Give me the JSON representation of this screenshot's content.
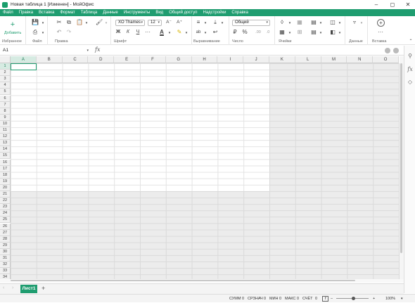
{
  "window": {
    "title": "Новая таблица 1 [Изменен] - МойОфис"
  },
  "menu": [
    "Файл",
    "Правка",
    "Вставка",
    "Формат",
    "Таблица",
    "Данные",
    "Инструменты",
    "Вид",
    "Общий доступ",
    "Надстройки",
    "Справка"
  ],
  "ribbon": {
    "add_label": "Добавить",
    "groups": {
      "favorites": "Избранное",
      "file": "Файл",
      "edit": "Правка",
      "font": "Шрифт",
      "align": "Выравнивание",
      "number": "Число",
      "cells": "Ячейки",
      "data": "Данные",
      "insert": "Вставка"
    },
    "font_name": "XO Thames",
    "font_size": "12",
    "number_format": "Общий",
    "bold_label": "Ж",
    "italic_label": "К",
    "underline_label": "Ч",
    "currency_label": "₽",
    "percent_label": "%"
  },
  "formula_bar": {
    "cell_ref": "A1",
    "fx_label": "fx"
  },
  "columns": [
    "A",
    "B",
    "C",
    "D",
    "E",
    "F",
    "G",
    "H",
    "I",
    "J",
    "K",
    "L",
    "M",
    "N",
    "O"
  ],
  "rows": [
    "1",
    "2",
    "3",
    "4",
    "5",
    "6",
    "7",
    "8",
    "9",
    "10",
    "11",
    "12",
    "13",
    "14",
    "15",
    "16",
    "17",
    "18",
    "19",
    "20",
    "21",
    "22",
    "23",
    "24",
    "25",
    "26",
    "27",
    "28",
    "29",
    "30",
    "31",
    "32",
    "33",
    "34"
  ],
  "sheet_tab": "Лист1",
  "status": {
    "sum_label": "СУММ",
    "sum_value": "0",
    "avg_label": "СРЗНАЧ",
    "avg_value": "0",
    "min_label": "МИН",
    "min_value": "0",
    "max_label": "МАКС",
    "max_value": "0",
    "count_label": "СЧЁТ",
    "count_value": "0",
    "zoom": "100%"
  },
  "colors": {
    "accent": "#1f9d70"
  }
}
